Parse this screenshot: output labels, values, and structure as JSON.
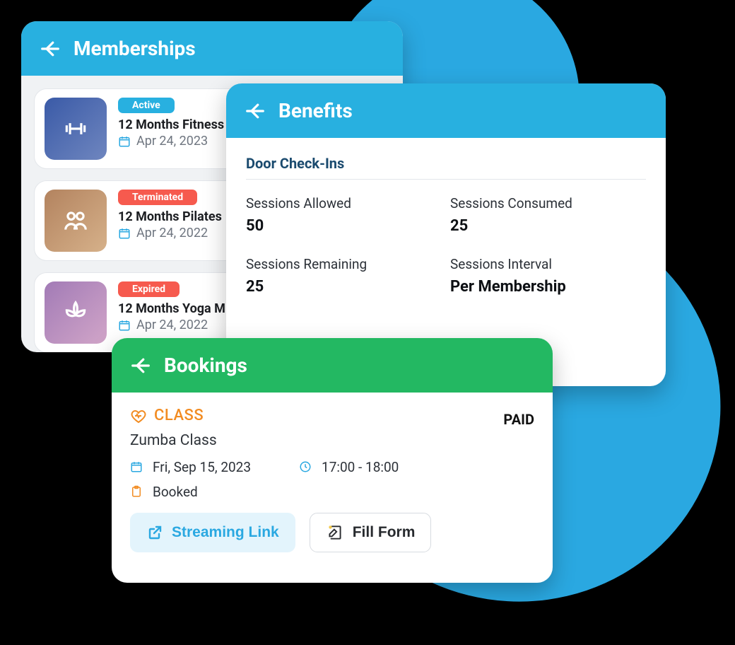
{
  "memberships": {
    "title": "Memberships",
    "items": [
      {
        "status": "Active",
        "name": "12 Months Fitness",
        "date": "Apr 24, 2023"
      },
      {
        "status": "Terminated",
        "name": "12 Months Pilates",
        "date": "Apr 24, 2022"
      },
      {
        "status": "Expired",
        "name": "12 Months Yoga M",
        "date": "Apr 24, 2022"
      }
    ]
  },
  "benefits": {
    "title": "Benefits",
    "section": "Door Check-Ins",
    "allowed_label": "Sessions Allowed",
    "allowed_value": "50",
    "consumed_label": "Sessions Consumed",
    "consumed_value": "25",
    "remaining_label": "Sessions Remaining",
    "remaining_value": "25",
    "interval_label": "Sessions Interval",
    "interval_value": "Per Membership"
  },
  "bookings": {
    "title": "Bookings",
    "class_tag": "CLASS",
    "paid": "PAID",
    "class_name": "Zumba Class",
    "date": "Fri, Sep 15, 2023",
    "time": "17:00 - 18:00",
    "status": "Booked",
    "streaming_btn": "Streaming Link",
    "form_btn": "Fill Form"
  }
}
